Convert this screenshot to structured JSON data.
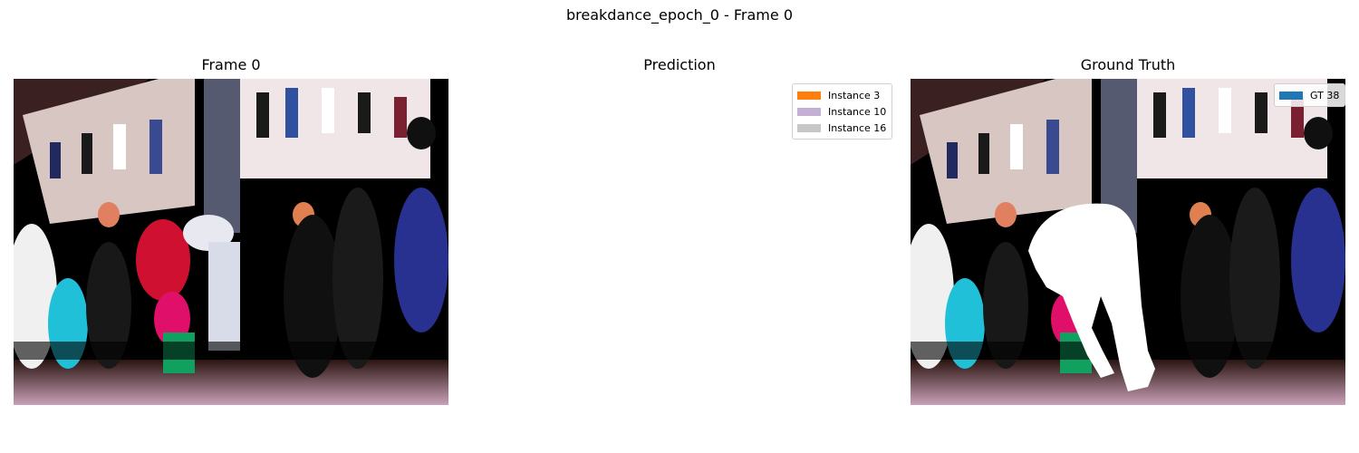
{
  "figure": {
    "title": "breakdance_epoch_0 - Frame 0"
  },
  "panels": [
    {
      "title": "Frame 0"
    },
    {
      "title": "Prediction",
      "legend": [
        {
          "label": "Instance 3",
          "color": "#ff7f0e"
        },
        {
          "label": "Instance 10",
          "color": "#c5b0d5"
        },
        {
          "label": "Instance 16",
          "color": "#c7c7c7"
        }
      ]
    },
    {
      "title": "Ground Truth",
      "legend": [
        {
          "label": "GT 38",
          "color": "#1f77b4"
        }
      ]
    }
  ]
}
